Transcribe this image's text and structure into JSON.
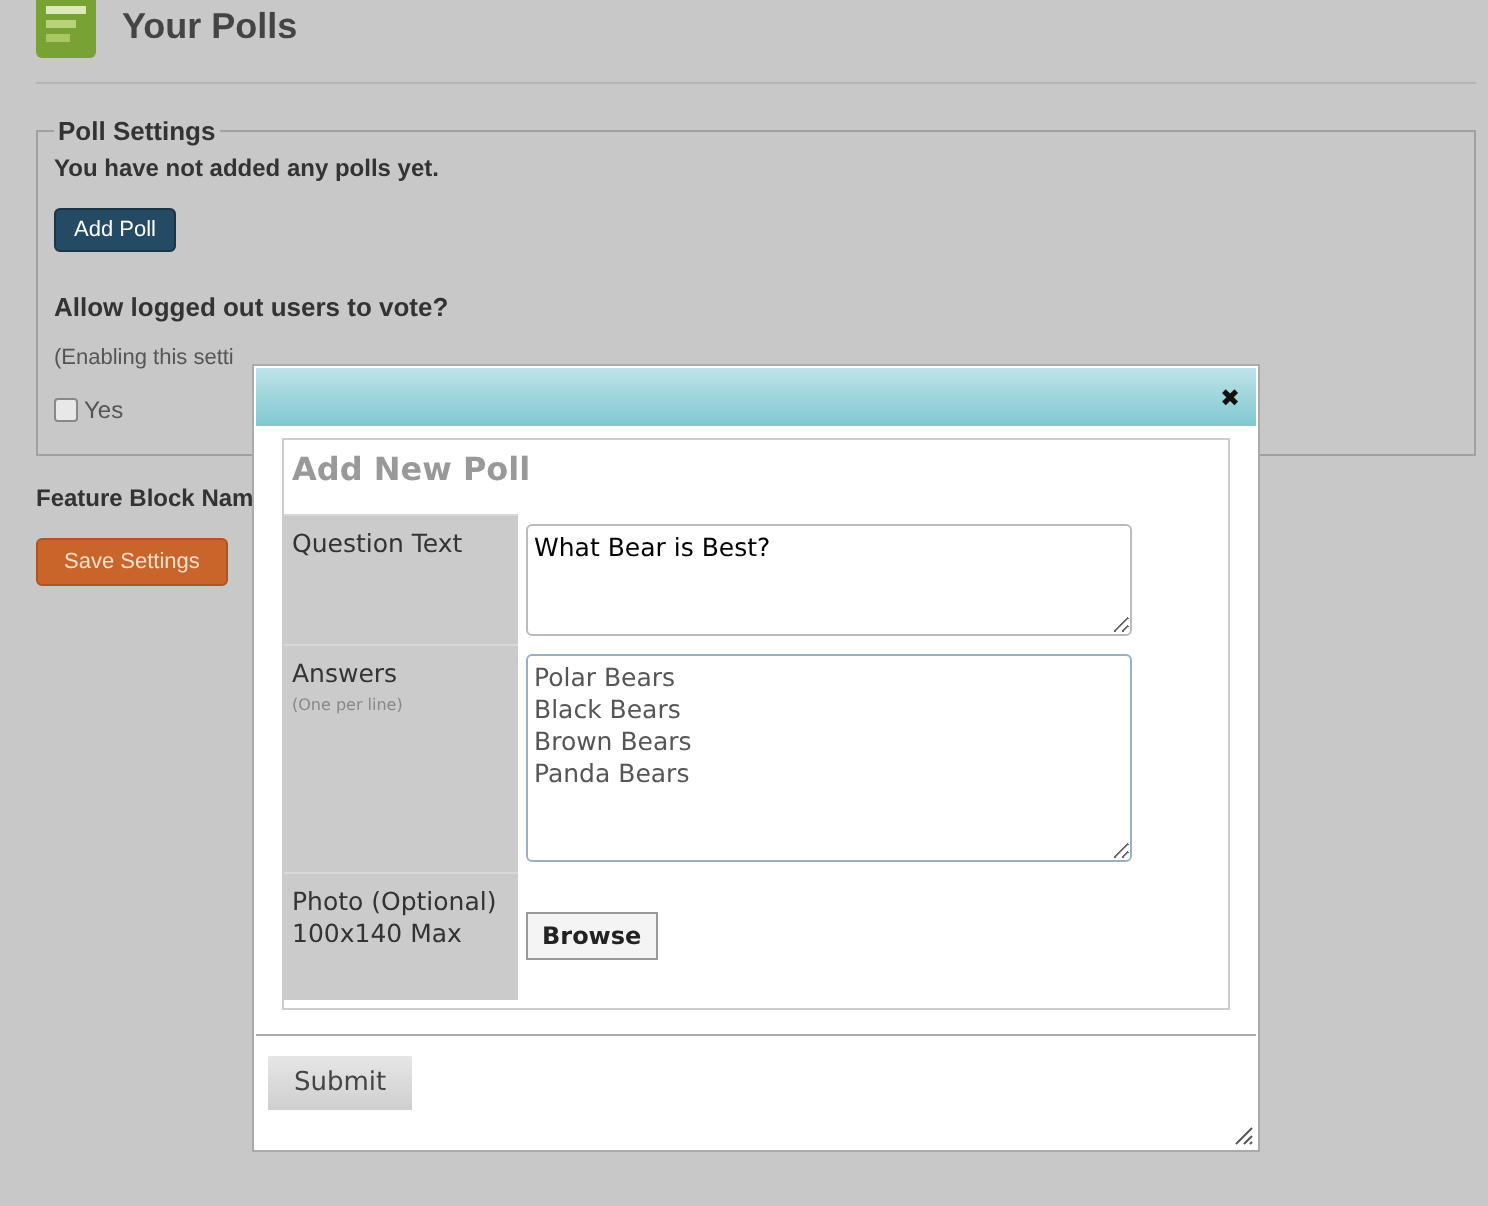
{
  "page": {
    "title": "Your Polls"
  },
  "poll_settings": {
    "legend": "Poll Settings",
    "empty_message": "You have not added any polls yet.",
    "add_button": "Add Poll",
    "question": "Allow logged out users to vote?",
    "note": "(Enabling this setti",
    "option": {
      "label": "Yes",
      "checked": false
    }
  },
  "feature_block": {
    "label": "Feature Block Nam"
  },
  "save_button": "Save Settings",
  "dialog": {
    "close": "✖",
    "title": "Add New Poll",
    "question": {
      "label": "Question Text",
      "value": "What Bear is Best?"
    },
    "answers": {
      "label": "Answers",
      "hint": "(One per line)",
      "values": [
        "Polar Bears",
        "Black Bears",
        "Brown Bears",
        "Panda Bears"
      ]
    },
    "photo": {
      "label": "Photo (Optional)",
      "size": "100x140 Max",
      "button": "Browse"
    },
    "submit": "Submit"
  }
}
